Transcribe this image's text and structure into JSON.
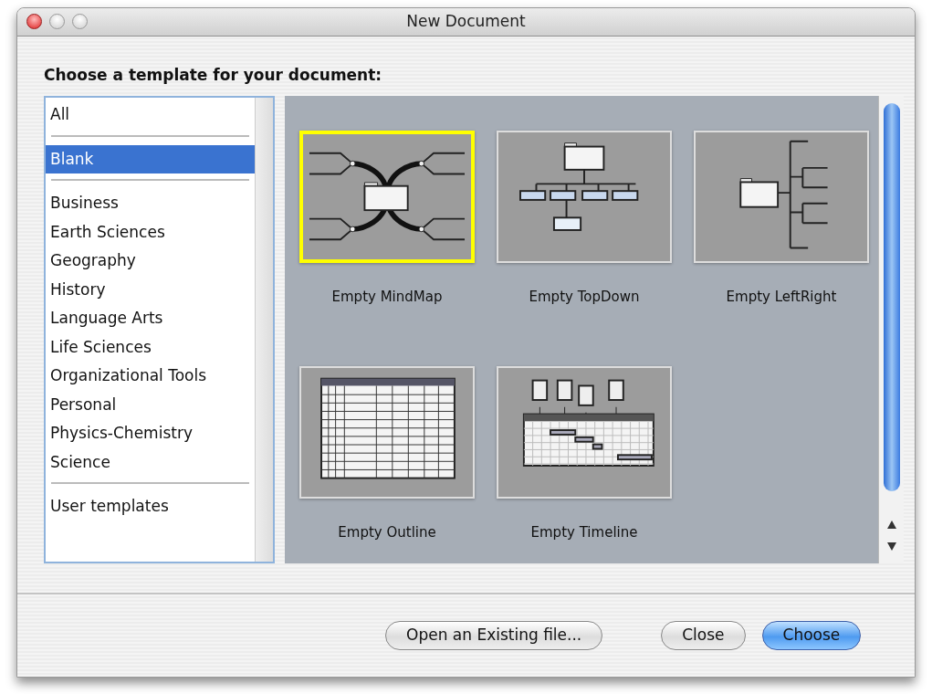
{
  "window": {
    "title": "New Document"
  },
  "heading": "Choose a template for your document:",
  "category_groups": [
    [
      {
        "label": "All",
        "selected": false
      }
    ],
    [
      {
        "label": "Blank",
        "selected": true
      }
    ],
    [
      {
        "label": "Business",
        "selected": false
      },
      {
        "label": "Earth Sciences",
        "selected": false
      },
      {
        "label": "Geography",
        "selected": false
      },
      {
        "label": "History",
        "selected": false
      },
      {
        "label": "Language Arts",
        "selected": false
      },
      {
        "label": "Life Sciences",
        "selected": false
      },
      {
        "label": "Organizational Tools",
        "selected": false
      },
      {
        "label": "Personal",
        "selected": false
      },
      {
        "label": "Physics-Chemistry",
        "selected": false
      },
      {
        "label": "Science",
        "selected": false
      }
    ],
    [
      {
        "label": "User templates",
        "selected": false
      }
    ]
  ],
  "templates": [
    {
      "kind": "mindmap",
      "label": "Empty MindMap",
      "selected": true
    },
    {
      "kind": "topdown",
      "label": "Empty TopDown",
      "selected": false
    },
    {
      "kind": "leftright",
      "label": "Empty LeftRight",
      "selected": false
    },
    {
      "kind": "outline",
      "label": "Empty Outline",
      "selected": false
    },
    {
      "kind": "timeline",
      "label": "Empty Timeline",
      "selected": false
    }
  ],
  "buttons": [
    {
      "label": "Open an Existing file...",
      "default": false
    },
    {
      "label": "Close",
      "default": false
    },
    {
      "label": "Choose",
      "default": true
    }
  ]
}
